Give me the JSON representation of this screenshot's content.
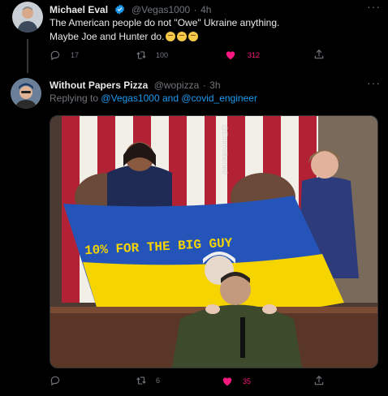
{
  "tweet1": {
    "name": "Michael Eval",
    "handle": "@Vegas1000",
    "time": "4h",
    "text_line1": "The American people do not \"Owe\" Ukraine anything.",
    "text_line2": "Maybe Joe and Hunter do.",
    "emojis": [
      "thinking-face",
      "thinking-face",
      "thinking-face"
    ],
    "replies": "17",
    "retweets": "100",
    "likes": "312",
    "more": "···"
  },
  "tweet2": {
    "name": "Without Papers Pizza",
    "handle": "@wopizza",
    "time": "3h",
    "replying_prefix": "Replying to",
    "replying_user1": "@Vegas1000",
    "replying_and": "and",
    "replying_user2": "@covid_engineer",
    "image": {
      "flag_text": "10% FOR THE BIG GUY",
      "watermark": "@Emmelbene0"
    },
    "replies": "",
    "retweets": "6",
    "likes": "35",
    "more": "···"
  },
  "colors": {
    "accent": "#1d9bf0",
    "like": "#f91880",
    "muted": "#71767b"
  }
}
